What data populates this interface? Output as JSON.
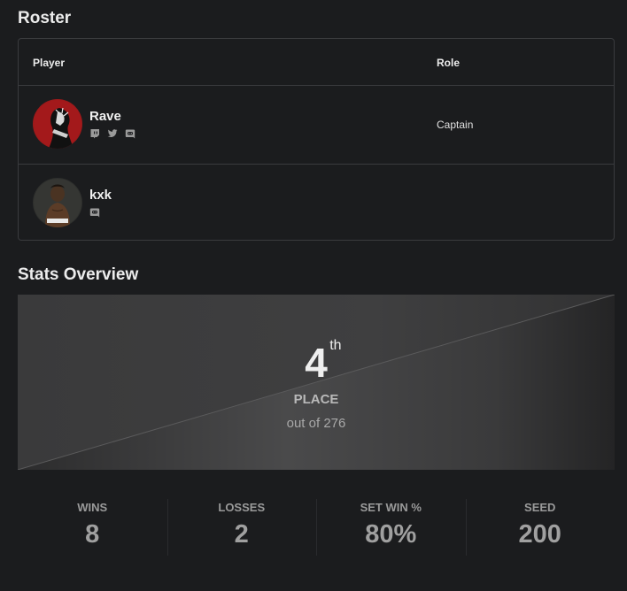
{
  "roster": {
    "title": "Roster",
    "columns": {
      "player": "Player",
      "role": "Role"
    },
    "players": [
      {
        "name": "Rave",
        "role": "Captain",
        "socials": [
          "twitch-icon",
          "twitter-icon",
          "discord-icon"
        ]
      },
      {
        "name": "kxk",
        "role": "",
        "socials": [
          "discord-icon"
        ]
      }
    ]
  },
  "stats": {
    "title": "Stats Overview",
    "place": {
      "number": "4",
      "suffix": "th",
      "label": "PLACE",
      "out_of": "out of 276"
    },
    "items": [
      {
        "label": "WINS",
        "value": "8"
      },
      {
        "label": "LOSSES",
        "value": "2"
      },
      {
        "label": "SET WIN %",
        "value": "80%"
      },
      {
        "label": "SEED",
        "value": "200"
      }
    ]
  },
  "colors": {
    "background": "#1b1c1e",
    "border": "#3a3b3e",
    "avatar_rave_accent": "#a3191b"
  }
}
